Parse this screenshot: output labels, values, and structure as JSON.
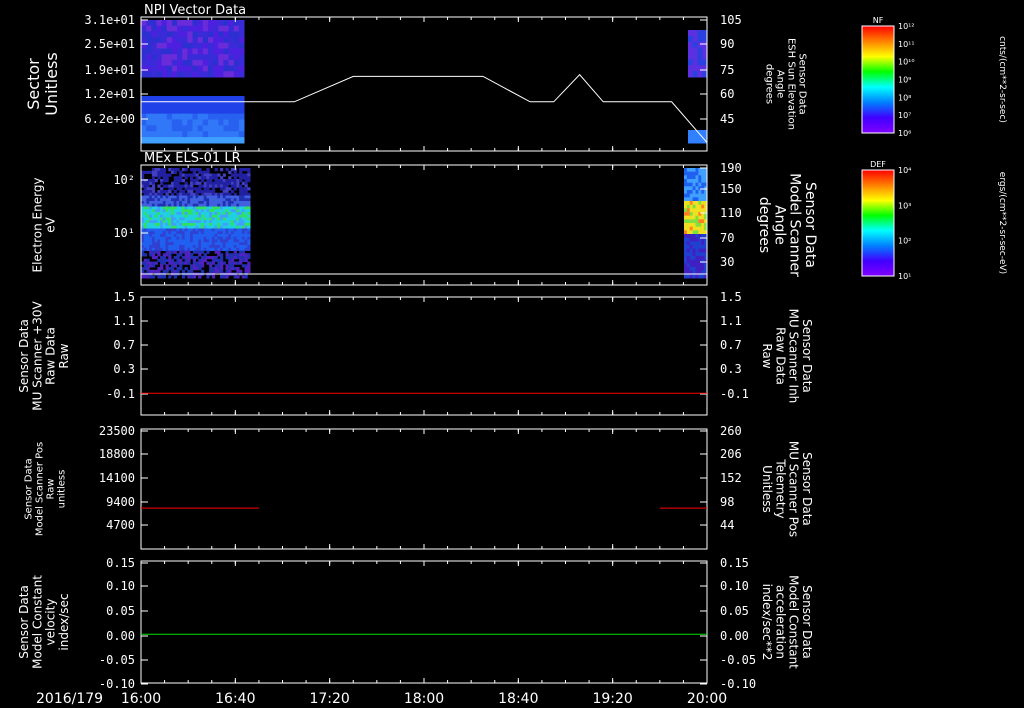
{
  "date_label": "2016/179",
  "time_ticks": [
    "16:00",
    "16:40",
    "17:20",
    "18:00",
    "18:40",
    "19:20",
    "20:00"
  ],
  "colors": {
    "red": "#ff0000",
    "green": "#00e000",
    "white": "#ffffff"
  },
  "chart_data": [
    {
      "type": "heatmap",
      "panel_title": "NPI Vector Data",
      "left_label": [
        "Sector",
        "Unitless"
      ],
      "left_ticks": [
        "3.1e+01",
        "2.5e+01",
        "1.9e+01",
        "1.2e+01",
        "6.2e+00"
      ],
      "right_ticks": [
        "105",
        "90",
        "75",
        "60",
        "45"
      ],
      "right_label": [
        "Sensor Data",
        "ESH Sun Elevation",
        "Angle",
        "degrees"
      ],
      "line_series": {
        "color": "#ffffff",
        "x": [
          "16:00",
          "17:05",
          "17:30",
          "18:25",
          "18:45",
          "18:55",
          "19:06",
          "19:16",
          "19:30",
          "19:45",
          "20:00"
        ],
        "y": [
          60,
          60,
          75,
          75,
          60,
          60,
          76,
          60,
          60,
          60,
          36
        ]
      },
      "colorbar": {
        "label": "NF",
        "units": "cnts/(cm**2-sr-sec)",
        "ticks": [
          "10¹²",
          "10¹¹",
          "10¹⁰",
          "10⁹",
          "10⁸",
          "10⁷",
          "10⁶"
        ]
      }
    },
    {
      "type": "heatmap",
      "panel_title": "MEx ELS-01 LR",
      "left_label": [
        "Electron Energy",
        "eV"
      ],
      "left_ticks": [
        "10²",
        "10¹"
      ],
      "right_ticks": [
        "190",
        "150",
        "110",
        "70",
        "30"
      ],
      "right_label": [
        "Sensor Data",
        "Model Scanner",
        "Angle",
        "degrees"
      ],
      "line_series": {
        "color": "#ffffff",
        "x": [
          "16:00",
          "20:00"
        ],
        "y": [
          10,
          10
        ]
      },
      "colorbar": {
        "label": "DEF",
        "units": "ergs/(cm**2-sr-sec-eV)",
        "ticks": [
          "10⁴",
          "10³",
          "10²",
          "10¹"
        ]
      }
    },
    {
      "type": "line",
      "left_label": [
        "Sensor Data",
        "MU Scanner +30V",
        "Raw Data",
        "Raw"
      ],
      "left_ticks": [
        "1.5",
        "1.1",
        "0.7",
        "0.3",
        "-0.1"
      ],
      "right_ticks": [
        "1.5",
        "1.1",
        "0.7",
        "0.3",
        "-0.1"
      ],
      "right_label": [
        "Sensor Data",
        "MU Scanner Inh",
        "Raw Data",
        "Raw"
      ],
      "ylim": [
        -0.4,
        1.5
      ],
      "series": [
        {
          "color": "#ff0000",
          "x": [
            "16:00",
            "20:00"
          ],
          "y": [
            -0.05,
            -0.05
          ]
        }
      ]
    },
    {
      "type": "line",
      "left_label": [
        "Sensor Data",
        "Model Scanner Pos",
        "Raw",
        "unitless"
      ],
      "left_ticks": [
        "23500",
        "18800",
        "14100",
        "9400",
        "4700"
      ],
      "right_ticks": [
        "260",
        "206",
        "152",
        "98",
        "44"
      ],
      "right_label": [
        "Sensor Data",
        "MU Scanner Pos",
        "Telemetry",
        "Unitless"
      ],
      "ylim": [
        0,
        23500
      ],
      "series": [
        {
          "color": "#ff0000",
          "segments": [
            {
              "x": [
                "16:00",
                "16:50"
              ],
              "y": [
                8000,
                8000
              ]
            },
            {
              "x": [
                "19:40",
                "20:00"
              ],
              "y": [
                8000,
                8000
              ]
            }
          ]
        }
      ]
    },
    {
      "type": "line",
      "left_label": [
        "Sensor Data",
        "Model Constant",
        "velocity",
        "index/sec"
      ],
      "left_ticks": [
        "0.15",
        "0.10",
        "0.05",
        "0.00",
        "-0.05",
        "-0.10"
      ],
      "right_ticks": [
        "0.15",
        "0.10",
        "0.05",
        "0.00",
        "-0.05",
        "-0.10"
      ],
      "right_label": [
        "Sensor Data",
        "Model Constant",
        "acceleration",
        "index/sec**2"
      ],
      "ylim": [
        -0.1,
        0.15
      ],
      "series": [
        {
          "color": "#00e000",
          "x": [
            "16:00",
            "20:00"
          ],
          "y": [
            0,
            0
          ]
        }
      ]
    }
  ]
}
